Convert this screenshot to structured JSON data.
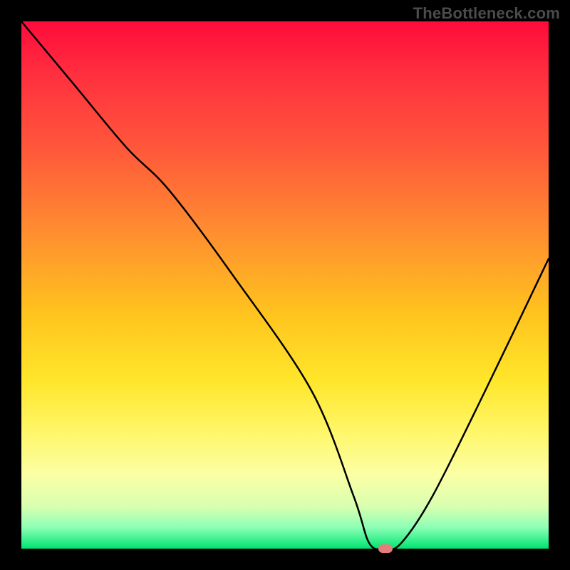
{
  "attribution": "TheBottleneck.com",
  "chart_data": {
    "type": "line",
    "title": "",
    "xlabel": "",
    "ylabel": "",
    "xlim": [
      0,
      100
    ],
    "ylim": [
      0,
      100
    ],
    "series": [
      {
        "name": "bottleneck-curve",
        "x": [
          0,
          10,
          20,
          28,
          40,
          55,
          63,
          66,
          69,
          72,
          78,
          88,
          100
        ],
        "y": [
          100,
          88,
          76,
          68,
          52,
          30,
          10,
          1,
          0,
          1,
          10,
          30,
          55
        ]
      }
    ],
    "marker": {
      "x": 69,
      "y": 0,
      "color": "#e77c7c"
    },
    "background_gradient": {
      "direction": "vertical",
      "stops": [
        {
          "pos": 0,
          "color": "#ff0b3b"
        },
        {
          "pos": 25,
          "color": "#ff5a3a"
        },
        {
          "pos": 55,
          "color": "#ffc21e"
        },
        {
          "pos": 78,
          "color": "#fff76a"
        },
        {
          "pos": 96,
          "color": "#8cffb5"
        },
        {
          "pos": 100,
          "color": "#00e571"
        }
      ]
    }
  }
}
